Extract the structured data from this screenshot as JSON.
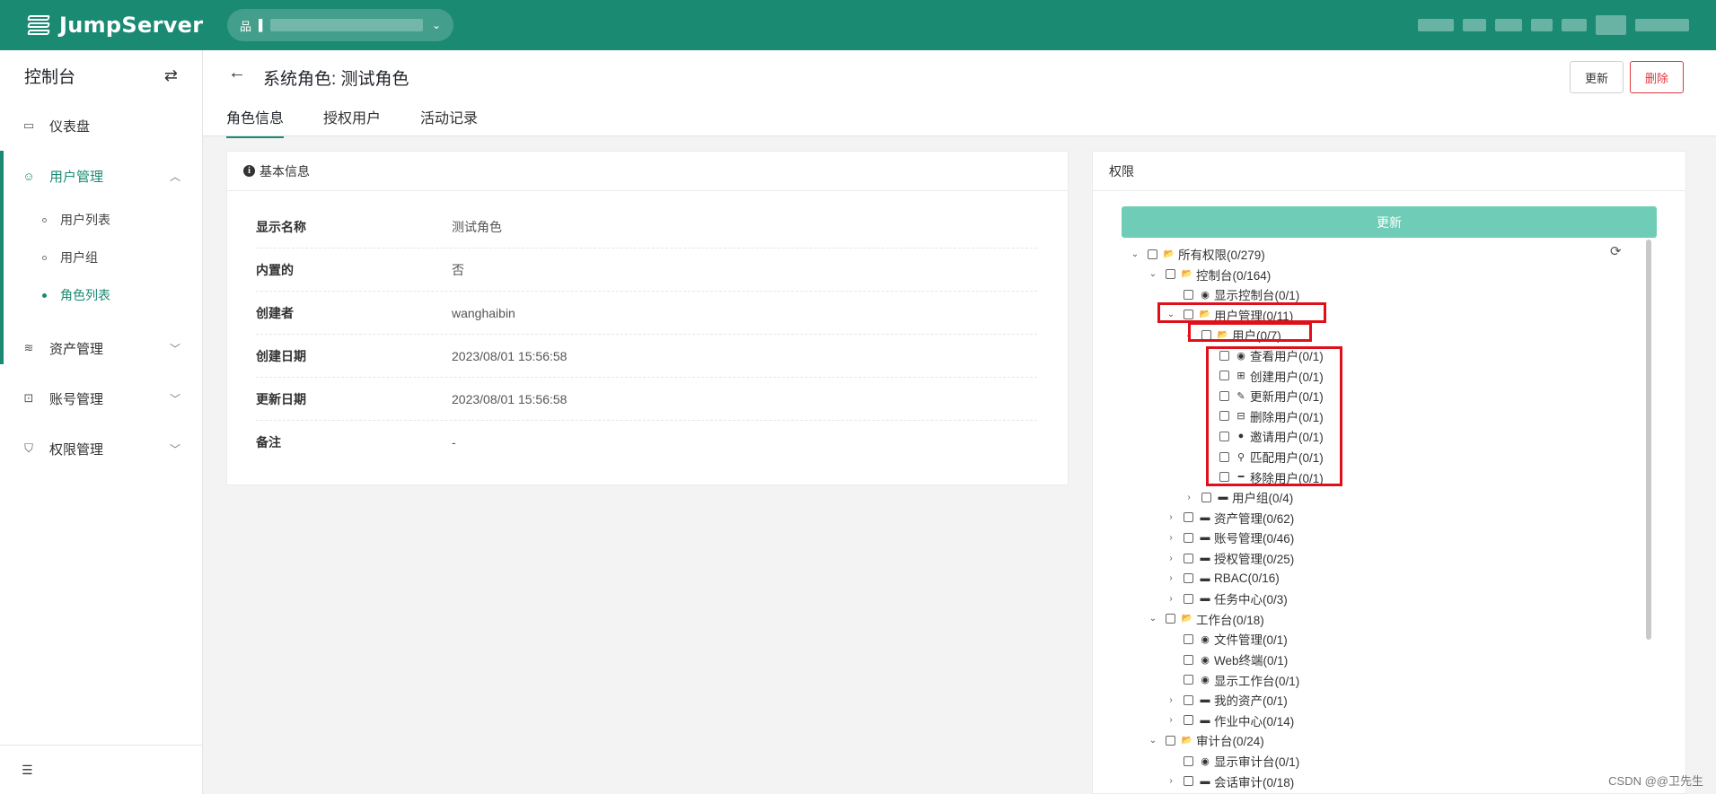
{
  "topbar": {
    "brand": "JumpServer",
    "org_icon": "sitemap-icon",
    "org_name": "▌"
  },
  "sidebar": {
    "title": "控制台",
    "items": [
      {
        "label": "仪表盘",
        "icon": "dashboard-icon"
      },
      {
        "label": "用户管理",
        "icon": "users-icon",
        "expanded": true,
        "children": [
          {
            "label": "用户列表"
          },
          {
            "label": "用户组"
          },
          {
            "label": "角色列表",
            "active": true
          }
        ]
      },
      {
        "label": "资产管理",
        "icon": "stack-icon"
      },
      {
        "label": "账号管理",
        "icon": "account-icon"
      },
      {
        "label": "权限管理",
        "icon": "shield-icon"
      }
    ]
  },
  "header": {
    "title": "系统角色: 测试角色",
    "tabs": [
      "角色信息",
      "授权用户",
      "活动记录"
    ],
    "active_tab": 0,
    "update_label": "更新",
    "delete_label": "删除"
  },
  "basic_info": {
    "title": "基本信息",
    "rows": [
      {
        "key": "显示名称",
        "value": "测试角色"
      },
      {
        "key": "内置的",
        "value": "否"
      },
      {
        "key": "创建者",
        "value": "wanghaibin"
      },
      {
        "key": "创建日期",
        "value": "2023/08/01 15:56:58"
      },
      {
        "key": "更新日期",
        "value": "2023/08/01 15:56:58"
      },
      {
        "key": "备注",
        "value": "-"
      }
    ]
  },
  "permissions": {
    "title": "权限",
    "update_label": "更新",
    "tree": [
      {
        "label": "所有权限(0/279)",
        "level": 0,
        "toggle": "open",
        "icon": "folder-open"
      },
      {
        "label": "控制台(0/164)",
        "level": 1,
        "toggle": "open",
        "icon": "folder-open"
      },
      {
        "label": "显示控制台(0/1)",
        "level": 2,
        "toggle": "none",
        "icon": "eye"
      },
      {
        "label": "用户管理(0/11)",
        "level": 2,
        "toggle": "open",
        "icon": "folder-open"
      },
      {
        "label": "用户(0/7)",
        "level": 3,
        "toggle": "open",
        "icon": "folder-open"
      },
      {
        "label": "查看用户(0/1)",
        "level": 4,
        "toggle": "none",
        "icon": "eye"
      },
      {
        "label": "创建用户(0/1)",
        "level": 4,
        "toggle": "none",
        "icon": "plus-square"
      },
      {
        "label": "更新用户(0/1)",
        "level": 4,
        "toggle": "none",
        "icon": "edit"
      },
      {
        "label": "删除用户(0/1)",
        "level": 4,
        "toggle": "none",
        "icon": "minus-square"
      },
      {
        "label": "邀请用户(0/1)",
        "level": 4,
        "toggle": "none",
        "icon": "user"
      },
      {
        "label": "匹配用户(0/1)",
        "level": 4,
        "toggle": "none",
        "icon": "search"
      },
      {
        "label": "移除用户(0/1)",
        "level": 4,
        "toggle": "none",
        "icon": "minus"
      },
      {
        "label": "用户组(0/4)",
        "level": 3,
        "toggle": "closed",
        "icon": "folder"
      },
      {
        "label": "资产管理(0/62)",
        "level": 2,
        "toggle": "closed",
        "icon": "folder"
      },
      {
        "label": "账号管理(0/46)",
        "level": 2,
        "toggle": "closed",
        "icon": "folder"
      },
      {
        "label": "授权管理(0/25)",
        "level": 2,
        "toggle": "closed",
        "icon": "folder"
      },
      {
        "label": "RBAC(0/16)",
        "level": 2,
        "toggle": "closed",
        "icon": "folder"
      },
      {
        "label": "任务中心(0/3)",
        "level": 2,
        "toggle": "closed",
        "icon": "folder"
      },
      {
        "label": "工作台(0/18)",
        "level": 1,
        "toggle": "open",
        "icon": "folder-open"
      },
      {
        "label": "文件管理(0/1)",
        "level": 2,
        "toggle": "none",
        "icon": "eye"
      },
      {
        "label": "Web终端(0/1)",
        "level": 2,
        "toggle": "none",
        "icon": "eye"
      },
      {
        "label": "显示工作台(0/1)",
        "level": 2,
        "toggle": "none",
        "icon": "eye"
      },
      {
        "label": "我的资产(0/1)",
        "level": 2,
        "toggle": "closed",
        "icon": "folder"
      },
      {
        "label": "作业中心(0/14)",
        "level": 2,
        "toggle": "closed",
        "icon": "folder"
      },
      {
        "label": "审计台(0/24)",
        "level": 1,
        "toggle": "open",
        "icon": "folder-open"
      },
      {
        "label": "显示审计台(0/1)",
        "level": 2,
        "toggle": "none",
        "icon": "eye"
      },
      {
        "label": "会话审计(0/18)",
        "level": 2,
        "toggle": "closed",
        "icon": "folder"
      }
    ]
  },
  "watermark": "CSDN @@卫先生"
}
